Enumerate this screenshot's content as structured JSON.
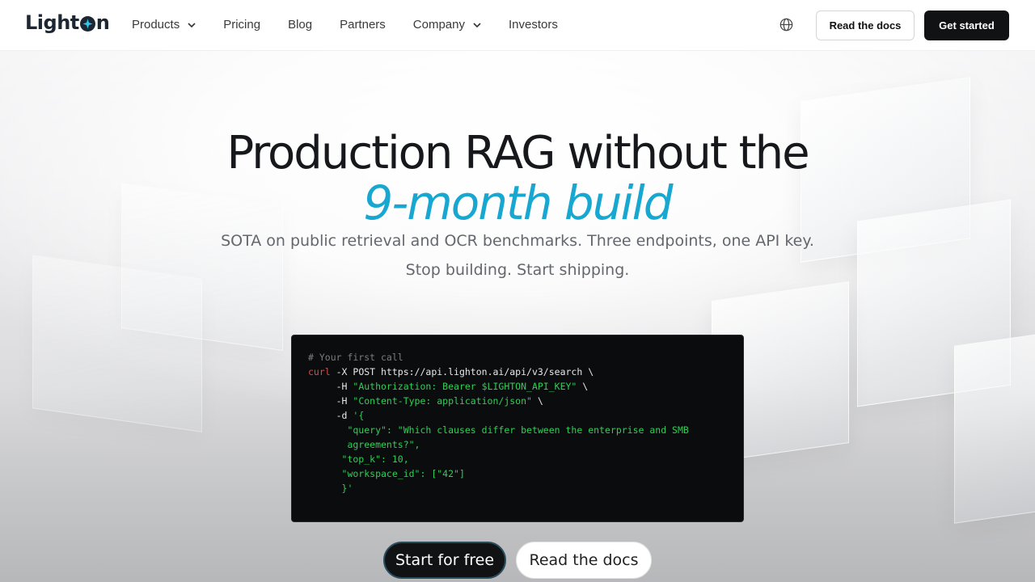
{
  "brand": {
    "name_part1": "Light",
    "name_part2": "n"
  },
  "nav": {
    "items": [
      {
        "label": "Products",
        "dropdown": true
      },
      {
        "label": "Pricing",
        "dropdown": false
      },
      {
        "label": "Blog",
        "dropdown": false
      },
      {
        "label": "Partners",
        "dropdown": false
      },
      {
        "label": "Company",
        "dropdown": true
      },
      {
        "label": "Investors",
        "dropdown": false
      }
    ],
    "read_docs": "Read the docs",
    "get_started": "Get started"
  },
  "hero": {
    "title_line1": "Production RAG without the",
    "title_line2": "9-month build",
    "subtitle_line1": "SOTA on public retrieval and OCR benchmarks. Three endpoints, one API key.",
    "subtitle_line2": "Stop building. Start shipping."
  },
  "code": {
    "comment": "# Your first call",
    "cmd": "curl",
    "line1_rest": " -X POST https://api.lighton.ai/api/v3/search \\",
    "h1_flag": "     -H ",
    "h1_val": "\"Authorization: Bearer $LIGHTON_API_KEY\"",
    "h1_tail": " \\",
    "h2_flag": "     -H ",
    "h2_val": "\"Content-Type: application/json\"",
    "h2_tail": " \\",
    "d_flag": "     -d ",
    "d_open": "'{",
    "q_key": "       \"query\"",
    "q_sep": ": ",
    "q_val1": "\"Which clauses differ between the enterprise and SMB",
    "q_val2": "       agreements?\",",
    "topk_key": "      \"top_k\"",
    "topk_val": ": 10,",
    "ws_key": "      \"workspace_id\"",
    "ws_val": ": [\"42\"]",
    "close": "      }'"
  },
  "cta": {
    "primary": "Start for free",
    "secondary": "Read the docs"
  },
  "colors": {
    "accent": "#17a7d0",
    "dark": "#111214"
  }
}
